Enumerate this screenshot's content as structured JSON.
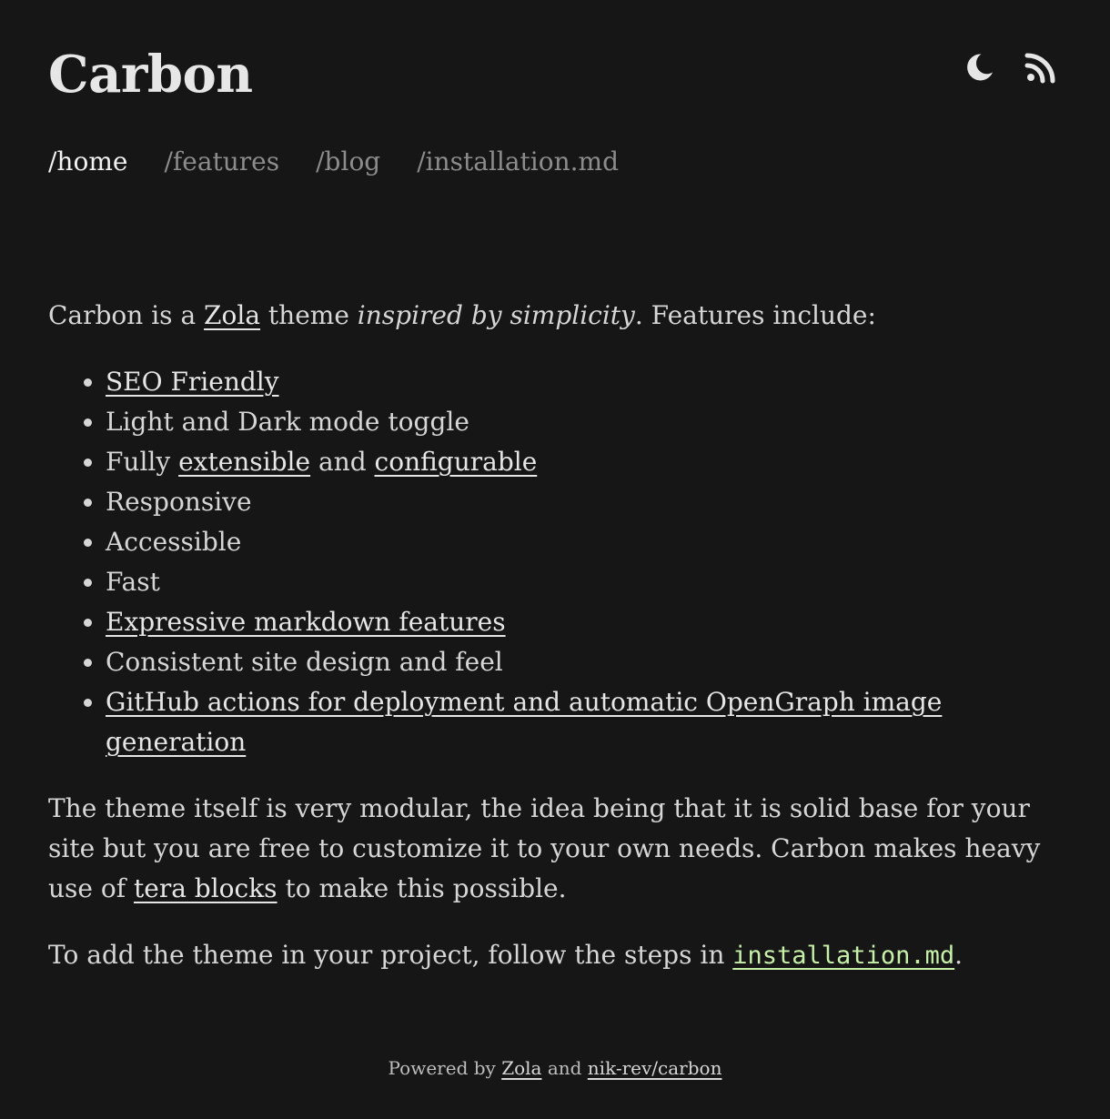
{
  "header": {
    "title": "Carbon",
    "icons": [
      "moon-icon",
      "rss-icon"
    ]
  },
  "nav": {
    "items": [
      {
        "label": "/home",
        "active": true
      },
      {
        "label": "/features",
        "active": false
      },
      {
        "label": "/blog",
        "active": false
      },
      {
        "label": "/installation.md",
        "active": false
      }
    ]
  },
  "intro": {
    "t1": "Carbon is a ",
    "zola_link": "Zola",
    "t2": " theme ",
    "emphasis": "inspired by simplicity",
    "t3": ". Features include:"
  },
  "features": {
    "seo": "SEO Friendly",
    "toggle": "Light and Dark mode toggle",
    "fully": "Fully ",
    "extensible": "extensible",
    "and": " and ",
    "configurable": "configurable",
    "responsive": "Responsive",
    "accessible": "Accessible",
    "fast": "Fast",
    "markdown": "Expressive markdown features",
    "consistent": "Consistent site design and feel",
    "github": "GitHub actions for deployment and automatic OpenGraph image generation"
  },
  "modular": {
    "t1": "The theme itself is very modular, the idea being that it is solid base for your site but you are free to customize it to your own needs. Carbon makes heavy use of ",
    "link": "tera blocks",
    "t2": " to make this possible."
  },
  "install": {
    "t1": "To add the theme in your project, follow the steps in ",
    "link": "installation.md",
    "t2": "."
  },
  "footer": {
    "t1": "Powered by ",
    "zola": "Zola",
    "and": " and ",
    "carbon": "nik-rev/carbon"
  },
  "colors": {
    "background": "#161616",
    "text": "#e6e6e6",
    "nav_inactive": "#8c8c8c",
    "code": "#c7f0a8"
  }
}
